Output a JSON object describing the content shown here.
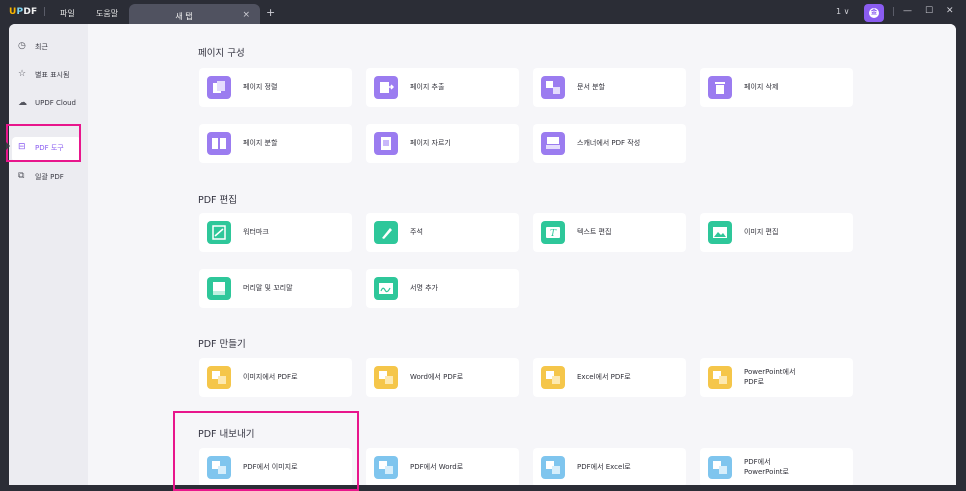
{
  "titlebar": {
    "logo": [
      "U",
      "P",
      "DF"
    ],
    "menu": [
      "파일",
      "도움말"
    ],
    "tab_title": "새 탭",
    "tab_close": "×",
    "new_tab": "+",
    "count": "1 ∨",
    "avatar_letter": "金",
    "minimize": "—",
    "maximize": "☐",
    "close": "✕"
  },
  "colors": {
    "highlight": "#e8168c",
    "purple": "#9b7cf0",
    "green": "#2ec79a",
    "yellow": "#f5c64a",
    "blue": "#7fc5ee"
  },
  "sidebar": {
    "items": [
      {
        "label": "최근",
        "icon": "clock-icon"
      },
      {
        "label": "별표 표시됨",
        "icon": "star-icon"
      },
      {
        "label": "UPDF Cloud",
        "icon": "cloud-icon"
      },
      {
        "label": "PDF 도구",
        "icon": "toolbox-icon",
        "active": true
      },
      {
        "label": "일괄 PDF",
        "icon": "batch-icon"
      }
    ]
  },
  "sections": {
    "organize": {
      "title": "페이지 구성",
      "items": [
        "페이지 정렬",
        "페이지 추출",
        "문서 분할",
        "페이지 삭제",
        "페이지 분할",
        "페이지 자르기",
        "스캐너에서 PDF 작성"
      ]
    },
    "edit": {
      "title": "PDF 편집",
      "items": [
        "워터마크",
        "주석",
        "텍스트 편집",
        "이미지 편집",
        "머리말 및 꼬리말",
        "서명 추가"
      ]
    },
    "create": {
      "title": "PDF 만들기",
      "items": [
        "이미지에서 PDF로",
        "Word에서 PDF로",
        "Excel에서 PDF로",
        "PowerPoint에서",
        "PDF로"
      ]
    },
    "export": {
      "title": "PDF 내보내기",
      "items": [
        "PDF에서 이미지로",
        "PDF에서 Word로",
        "PDF에서 Excel로",
        "PDF에서",
        "PowerPoint로"
      ]
    }
  }
}
